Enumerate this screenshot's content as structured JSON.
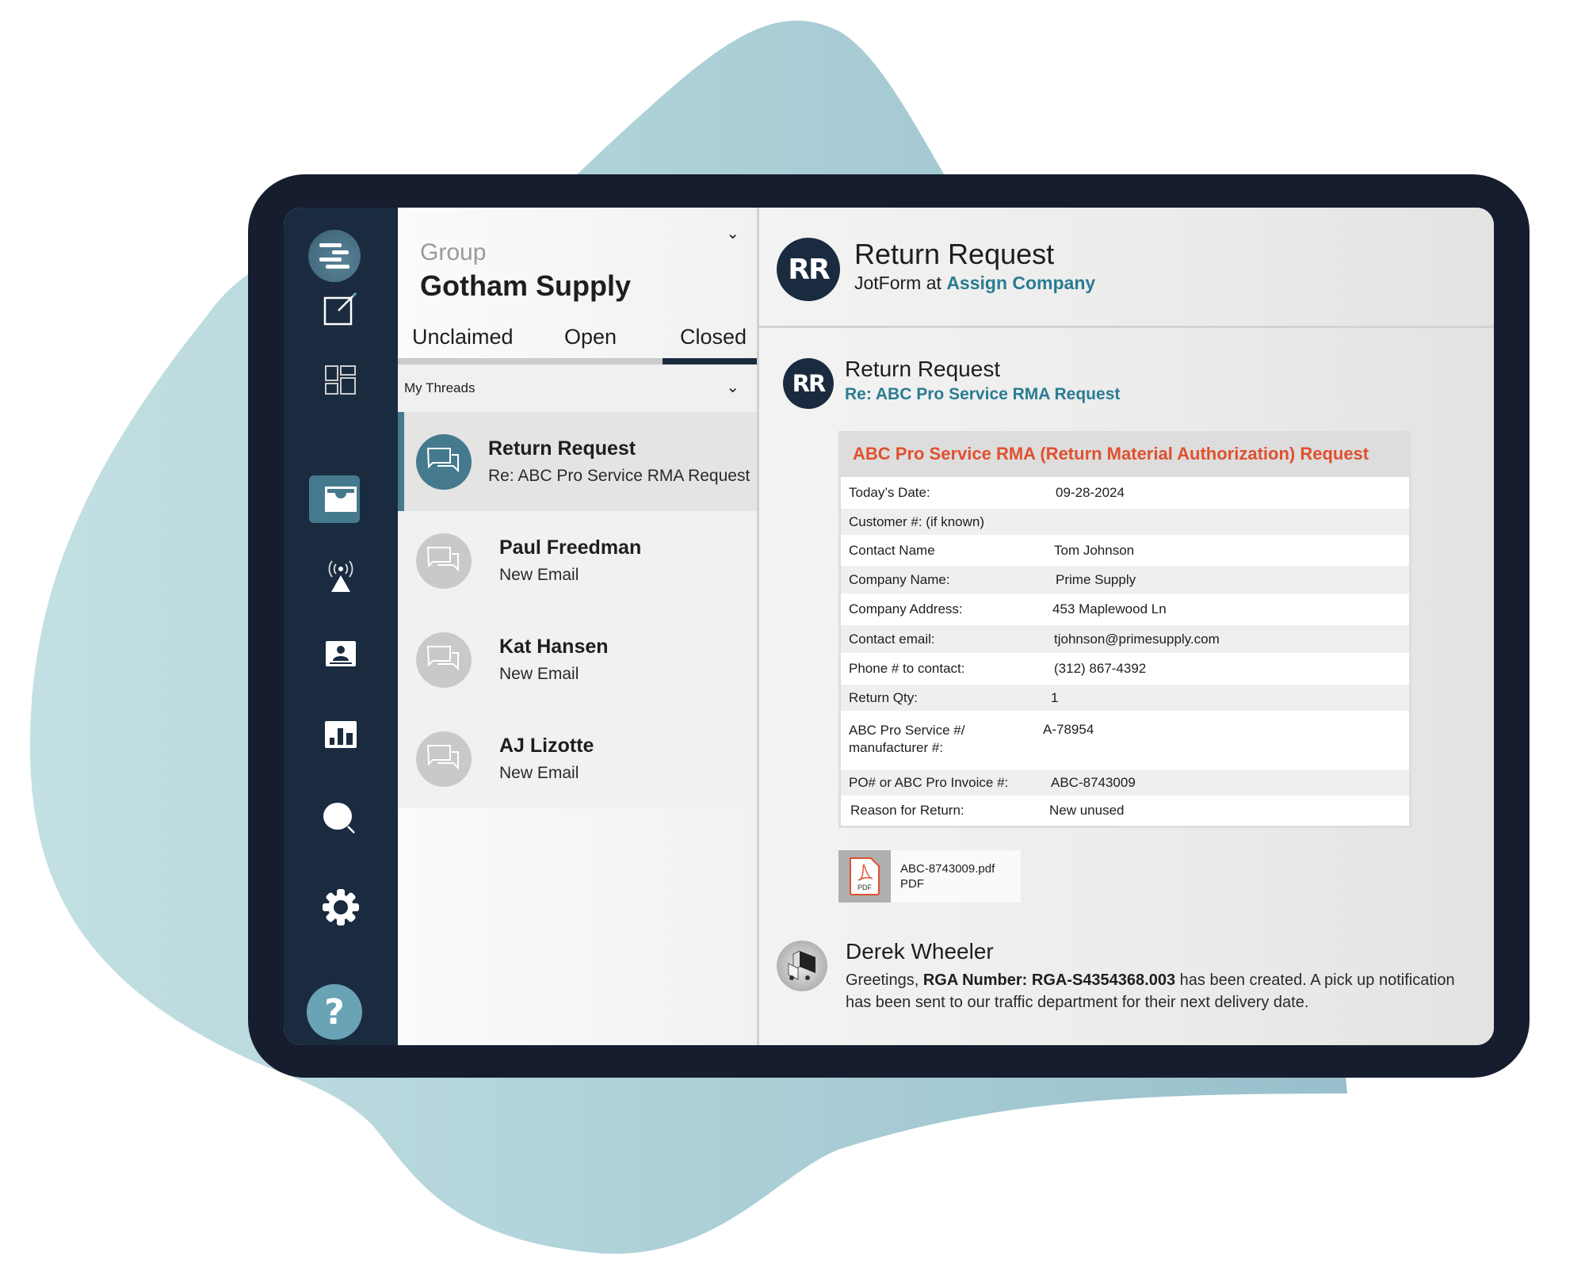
{
  "colors": {
    "sidebar_bg": "#1a2b40",
    "accent": "#457a8e",
    "link": "#2a7c93",
    "form_title": "#e0502f",
    "help_button": "#6aa3b5"
  },
  "sidebar": {
    "logo": "logo-icon",
    "items": [
      {
        "icon": "compose-icon",
        "label": "Compose"
      },
      {
        "icon": "dashboard-icon",
        "label": "Dashboard"
      },
      {
        "icon": "inbox-icon",
        "label": "Inbox",
        "active": true
      },
      {
        "icon": "broadcast-icon",
        "label": "Broadcast"
      },
      {
        "icon": "contacts-icon",
        "label": "Contacts"
      },
      {
        "icon": "reports-icon",
        "label": "Reports"
      },
      {
        "icon": "search-icon",
        "label": "Search"
      },
      {
        "icon": "settings-icon",
        "label": "Settings"
      }
    ],
    "help_label": "?"
  },
  "threads_panel": {
    "group_label": "Group",
    "group_name": "Gotham Supply",
    "group_chevron": "⌄",
    "tabs": [
      {
        "label": "Unclaimed",
        "active": false
      },
      {
        "label": "Open",
        "active": false
      },
      {
        "label": "Closed",
        "active": true
      }
    ],
    "filter": {
      "label": "My Threads",
      "chevron": "⌄"
    },
    "threads": [
      {
        "name": "Return Request",
        "subtitle": "Re: ABC Pro Service RMA Request",
        "selected": true
      },
      {
        "name": "Paul Freedman",
        "subtitle": "New Email",
        "selected": false
      },
      {
        "name": "Kat Hansen",
        "subtitle": "New Email",
        "selected": false
      },
      {
        "name": "AJ Lizotte",
        "subtitle": "New Email",
        "selected": false
      }
    ]
  },
  "conversation": {
    "header": {
      "initials": "RR",
      "title": "Return Request",
      "source_prefix": "JotForm at",
      "source_link": "Assign Company"
    },
    "message": {
      "initials": "RR",
      "title": "Return Request",
      "subject": "Re: ABC Pro Service RMA Request",
      "form": {
        "title": "ABC Pro Service RMA (Return Material Authorization)  Request",
        "rows": [
          {
            "label": "Today’s Date:",
            "value": "09-28-2024"
          },
          {
            "label": "Customer #: (if known)",
            "value": ""
          },
          {
            "label": "Contact Name",
            "value": "Tom Johnson"
          },
          {
            "label": "Company Name:",
            "value": "Prime Supply"
          },
          {
            "label": "Company Address:",
            "value": "453 Maplewood Ln"
          },
          {
            "label": "Contact email:",
            "value": "tjohnson@primesupply.com"
          },
          {
            "label": "Phone # to contact:",
            "value": "(312) 867-4392"
          },
          {
            "label": "Return Qty:",
            "value": "1"
          },
          {
            "label": "ABC Pro Service #/ manufacturer #:",
            "value": "A-78954"
          },
          {
            "label": "PO# or ABC Pro Invoice #:",
            "value": "ABC-8743009"
          },
          {
            "label": "Reason for Return:",
            "value": "New unused"
          }
        ]
      },
      "attachment": {
        "filename": "ABC-8743009.pdf",
        "type": "PDF",
        "icon_label": "PDF"
      }
    },
    "reply": {
      "author": "Derek Wheeler",
      "text_before": "Greetings, ",
      "text_bold": "RGA Number: RGA-S4354368.003",
      "text_after": " has been created. A pick up notification has been sent to our traffic department for their next delivery date."
    }
  }
}
